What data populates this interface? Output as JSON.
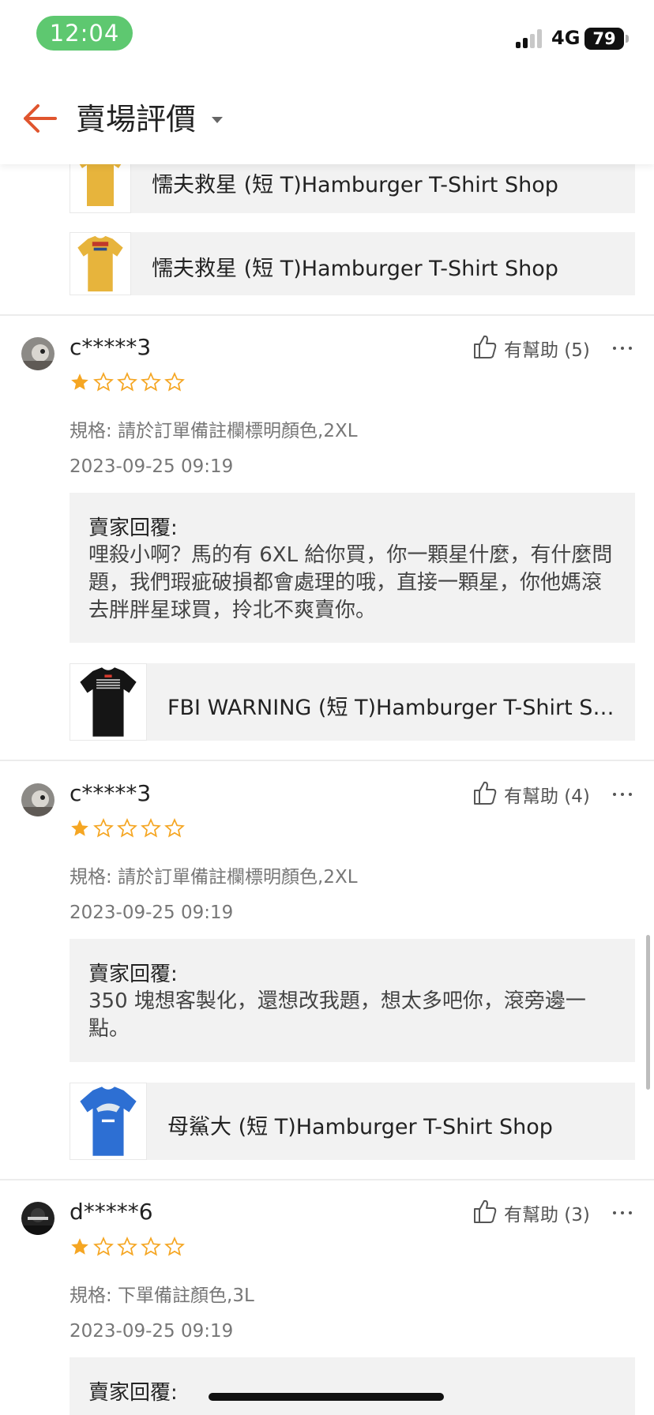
{
  "status_bar": {
    "time": "12:04",
    "network": "4G",
    "battery": "79"
  },
  "header": {
    "title": "賣場評價"
  },
  "top_products": [
    {
      "name": "懦夫救星 (短 T)Hamburger T-Shirt Shop",
      "thumb_color": "#e7b43c"
    },
    {
      "name": "懦夫救星 (短 T)Hamburger T-Shirt Shop",
      "thumb_color": "#e7b43c"
    }
  ],
  "reviews": [
    {
      "user": "c*****3",
      "helpful": "有幫助 (5)",
      "rating": 1,
      "spec": "規格: 請於訂單備註欄標明顏色,2XL",
      "date": "2023-09-25 09:19",
      "reply_label": "賣家回覆:",
      "reply_text": "哩殺小啊？馬的有 6XL 給你買，你一顆星什麼，有什麼問題，我們瑕疵破損都會處理的哦，直接一顆星，你他媽滾去胖胖星球買，拎北不爽賣你。",
      "product": "FBI WARNING (短 T)Hamburger T-Shirt Sh...",
      "product_color": "#151515"
    },
    {
      "user": "c*****3",
      "helpful": "有幫助 (4)",
      "rating": 1,
      "spec": "規格: 請於訂單備註欄標明顏色,2XL",
      "date": "2023-09-25 09:19",
      "reply_label": "賣家回覆:",
      "reply_text": "350 塊想客製化，還想改我題，想太多吧你，滾旁邊一點。",
      "product": "母鯊大 (短 T)Hamburger T-Shirt Shop",
      "product_color": "#2d6fd3"
    },
    {
      "user": "d*****6",
      "helpful": "有幫助 (3)",
      "rating": 1,
      "spec": "規格: 下單備註顏色,3L",
      "date": "2023-09-25 09:19",
      "reply_label": "賣家回覆:"
    }
  ],
  "colors": {
    "accent": "#e0552e",
    "star": "#f5a623",
    "time_pill": "#5ec870",
    "card_bg": "#f2f2f2"
  }
}
